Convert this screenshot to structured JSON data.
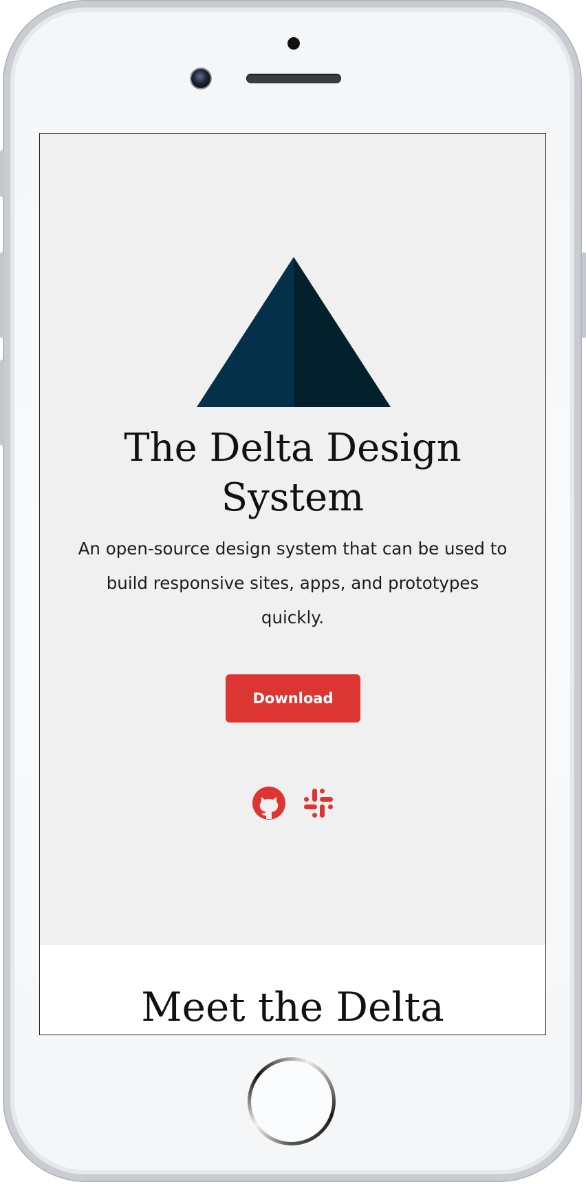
{
  "hero": {
    "title": "The Delta Design System",
    "description": "An open-source design system that can be used to build responsive sites, apps, and prototypes quickly.",
    "download_label": "Download",
    "links": [
      {
        "name": "GitHub",
        "icon": "github-icon"
      },
      {
        "name": "Slack",
        "icon": "slack-icon"
      }
    ]
  },
  "section": {
    "title": "Meet the Delta"
  },
  "colors": {
    "accent": "#dd3632",
    "logo_light": "#05304a",
    "logo_dark": "#03212c",
    "hero_background": "#f0f0f0"
  }
}
